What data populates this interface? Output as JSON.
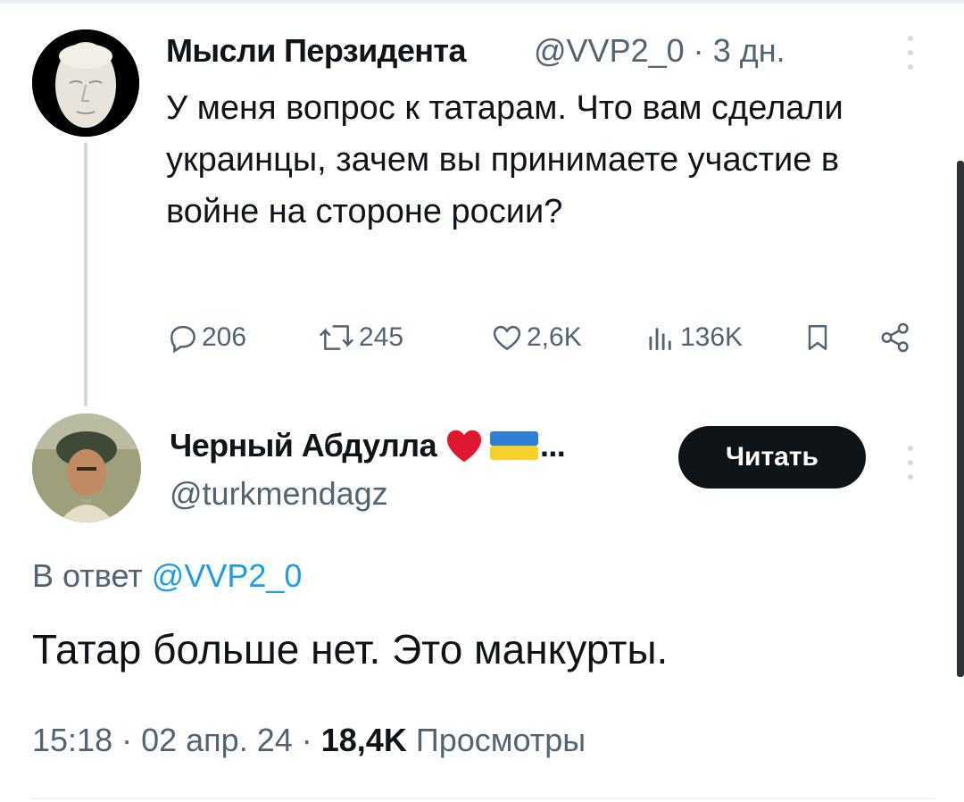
{
  "tweet": {
    "author_name": "Мысли Перзидента",
    "handle": "@VVP2_0",
    "separator": "·",
    "time": "3 дн.",
    "text": "У меня вопрос к татарам. Что вам сделали украинцы, зачем вы принимаете участие в войне на стороне росии?",
    "actions": {
      "replies": "206",
      "reposts": "245",
      "likes": "2,6K",
      "views": "136K"
    }
  },
  "reply": {
    "author_name": "Черный Абдулла",
    "name_suffix": "...",
    "emoji": [
      "red-heart",
      "ukraine-flag"
    ],
    "handle": "@turkmendagz",
    "follow_label": "Читать",
    "reply_to_prefix": "В ответ",
    "reply_to_handle": "@VVP2_0",
    "text": "Татар больше нет. Это манкурты.",
    "time": "15:18",
    "date": "02 апр. 24",
    "views_count": "18,4K",
    "views_label": "Просмотры"
  },
  "colors": {
    "text": "#0f1419",
    "secondary": "#536471",
    "link": "#1d9bf0",
    "button": "#0f1419",
    "thread_line": "#cfd9de"
  }
}
